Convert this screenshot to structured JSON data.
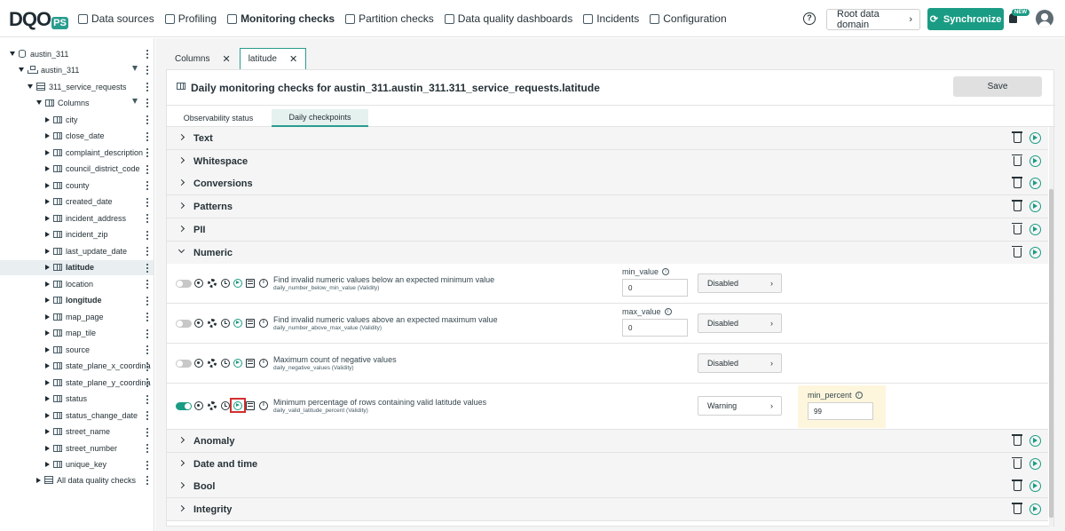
{
  "logo": {
    "text": "DQO",
    "suffix": "PS"
  },
  "nav": {
    "items": [
      {
        "label": "Data sources",
        "icon": "database-icon",
        "active": false
      },
      {
        "label": "Profiling",
        "icon": "profiling-icon",
        "active": false
      },
      {
        "label": "Monitoring checks",
        "icon": "monitoring-icon",
        "active": true
      },
      {
        "label": "Partition checks",
        "icon": "partition-icon",
        "active": false
      },
      {
        "label": "Data quality dashboards",
        "icon": "dashboard-icon",
        "active": false
      },
      {
        "label": "Incidents",
        "icon": "warning-icon",
        "active": false
      },
      {
        "label": "Configuration",
        "icon": "gear-icon",
        "active": false
      }
    ],
    "domain_button": "Root data domain",
    "sync_button": "Synchronize",
    "new_badge": "NEW"
  },
  "tree": {
    "connection": "austin_311",
    "schema": "austin_311",
    "table": "311_service_requests",
    "columns_label": "Columns",
    "columns": [
      "city",
      "close_date",
      "complaint_description",
      "council_district_code",
      "county",
      "created_date",
      "incident_address",
      "incident_zip",
      "last_update_date",
      "latitude",
      "location",
      "longitude",
      "map_page",
      "map_tile",
      "source",
      "state_plane_x_coordina",
      "state_plane_y_coordina",
      "status",
      "status_change_date",
      "street_name",
      "street_number",
      "unique_key"
    ],
    "selected": "latitude",
    "bold_items": [
      "longitude"
    ],
    "all_checks": "All data quality checks"
  },
  "tabs": [
    {
      "label": "Columns",
      "active": false
    },
    {
      "label": "latitude",
      "active": true
    }
  ],
  "panel": {
    "title": "Daily monitoring checks for austin_311.austin_311.311_service_requests.latitude",
    "save_label": "Save",
    "subtabs": [
      "Observability status",
      "Daily checkpoints"
    ]
  },
  "groups_top": [
    "Text",
    "Whitespace",
    "Conversions",
    "Patterns",
    "PII"
  ],
  "numeric_group": "Numeric",
  "groups_bottom": [
    "Anomaly",
    "Date and time",
    "Bool",
    "Integrity"
  ],
  "checks": [
    {
      "title": "Find invalid numeric values below an expected minimum value",
      "name": "daily_number_below_min_value (Validity)",
      "enabled": false,
      "param_label": "min_value",
      "param_value": "0",
      "severity": "Disabled"
    },
    {
      "title": "Find invalid numeric values above an expected maximum value",
      "name": "daily_number_above_max_value (Validity)",
      "enabled": false,
      "param_label": "max_value",
      "param_value": "0",
      "severity": "Disabled"
    },
    {
      "title": "Maximum count of negative values",
      "name": "daily_negative_values (Validity)",
      "enabled": false,
      "param_label": "",
      "param_value": "",
      "severity": "Disabled"
    },
    {
      "title": "Minimum percentage of rows containing valid latitude values",
      "name": "daily_valid_latitude_percent (Validity)",
      "enabled": true,
      "param_label": "",
      "param_value": "",
      "severity": "Warning",
      "rule_label": "min_percent",
      "rule_value": "99"
    }
  ],
  "colors": {
    "accent": "#1a9c84",
    "highlight": "#d32f2f",
    "warning_bg": "#fdf6dc"
  }
}
